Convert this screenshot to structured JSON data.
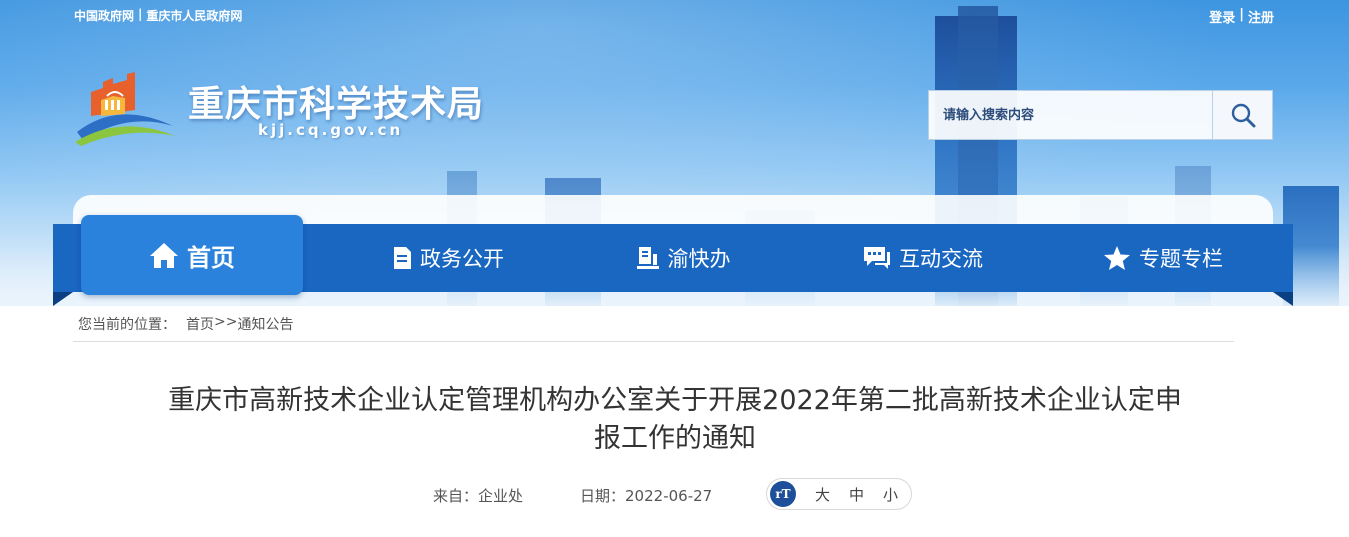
{
  "header": {
    "gov_links": [
      "中国政府网",
      "重庆市人民政府网"
    ],
    "separator": "|",
    "user_links": {
      "login": "登录",
      "register": "注册"
    },
    "site_title": "重庆市科学技术局",
    "site_domain": "kjj.cq.gov.cn",
    "search": {
      "placeholder": "请输入搜索内容",
      "button_icon": "search-icon"
    }
  },
  "nav": {
    "items": [
      {
        "label": "首页",
        "icon": "home-icon",
        "active": true
      },
      {
        "label": "政务公开",
        "icon": "document-icon",
        "active": false
      },
      {
        "label": "渝快办",
        "icon": "book-icon",
        "active": false
      },
      {
        "label": "互动交流",
        "icon": "chat-icon",
        "active": false
      },
      {
        "label": "专题专栏",
        "icon": "star-icon",
        "active": false
      }
    ]
  },
  "breadcrumb": {
    "prefix": "您当前的位置：",
    "home": "首页",
    "sep": ">>",
    "current": "通知公告"
  },
  "article": {
    "title_line1": "重庆市高新技术企业认定管理机构办公室关于开展2022年第二批高新技术企业认定申",
    "title_line2": "报工作的通知",
    "source_label": "来自：",
    "source": "企业处",
    "date_label": "日期：",
    "date": "2022-06-27",
    "font_size": {
      "icon_text": "rT",
      "large": "大",
      "medium": "中",
      "small": "小"
    }
  },
  "colors": {
    "nav_bg": "#1a67c2",
    "nav_active": "#2a82dc",
    "banner_top": "#3d95e0"
  }
}
